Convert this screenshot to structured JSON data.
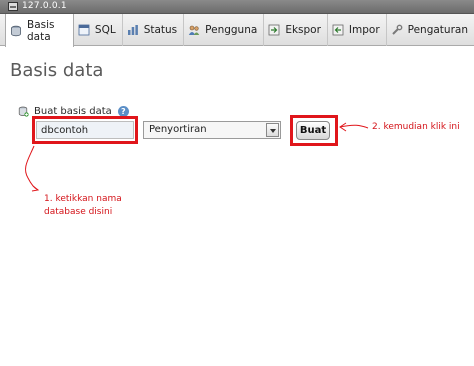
{
  "server": {
    "label": "127.0.0.1"
  },
  "tabs": [
    {
      "label": "Basis data",
      "icon": "database-icon",
      "active": true
    },
    {
      "label": "SQL",
      "icon": "sql-icon"
    },
    {
      "label": "Status",
      "icon": "status-chart-icon"
    },
    {
      "label": "Pengguna",
      "icon": "users-icon"
    },
    {
      "label": "Ekspor",
      "icon": "export-icon"
    },
    {
      "label": "Impor",
      "icon": "import-icon"
    },
    {
      "label": "Pengaturan",
      "icon": "wrench-icon"
    }
  ],
  "page": {
    "title": "Basis data"
  },
  "create_db": {
    "label": "Buat basis data",
    "help_icon": "help-icon",
    "name_value": "dbcontoh",
    "collation_value": "Penyortiran",
    "submit_label": "Buat"
  },
  "annotations": {
    "step1_line1": "1. ketikkan nama",
    "step1_line2": "database disini",
    "step2": "2. kemudian klik ini",
    "color": "#e0161b"
  }
}
